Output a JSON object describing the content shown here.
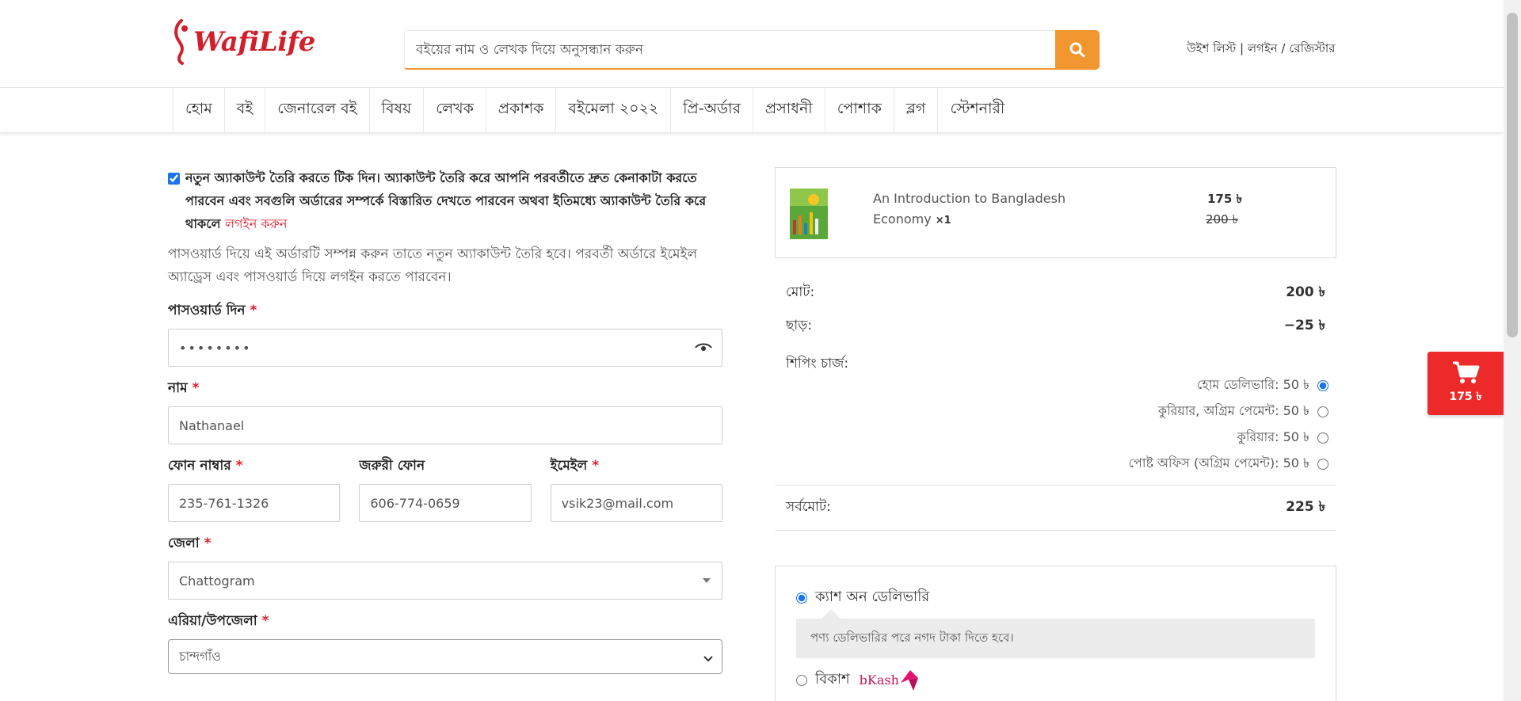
{
  "header": {
    "logo_text": "WafiLife",
    "search_placeholder": "বইয়ের নাম ও লেখক দিয়ে অনুসন্ধান করুন",
    "wishlist": "উইশ লিস্ট",
    "separator": "|",
    "login": "লগইন",
    "slash": "/",
    "register": "রেজিস্টার"
  },
  "nav": {
    "items": [
      "হোম",
      "বই",
      "জেনারেল বই",
      "বিষয়",
      "লেখক",
      "প্রকাশক",
      "বইমেলা ২০২২",
      "প্রি-অর্ডার",
      "প্রসাধনী",
      "পোশাক",
      "ব্লগ",
      "স্টেশনারী"
    ]
  },
  "form": {
    "account_notice": "নতুন অ্যাকাউন্ট তৈরি করতে টিক দিন। অ্যাকাউন্ট তৈরি করে আপনি পরবর্তীতে দ্রুত কেনাকাটা করতে পারবেন এবং সবগুলি অর্ডারের সম্পর্কে বিস্তারিত দেখতে পারবেন অথবা ইতিমধ্যে অ্যাকাউন্ট তৈরি করে থাকলে",
    "login_link": "লগইন করুন",
    "account_checked": true,
    "info_text": "পাসওয়ার্ড দিয়ে এই অর্ডারটি সম্পন্ন করুন তাতে নতুন অ্যাকাউন্ট তৈরি হবে। পরবর্তী অর্ডারে ইমেইল অ্যাড্রেস এবং পাসওয়ার্ড দিয়ে লগইন করতে পারবেন।",
    "required_mark": "*",
    "password_label": "পাসওয়ার্ড দিন",
    "password_value": "••••••••",
    "name_label": "নাম",
    "name_value": "Nathanael",
    "phone_label": "ফোন নাম্বার",
    "phone_value": "235-761-1326",
    "alt_phone_label": "জরুরী ফোন",
    "alt_phone_value": "606-774-0659",
    "email_label": "ইমেইল",
    "email_value": "vsik23@mail.com",
    "district_label": "জেলা",
    "district_value": "Chattogram",
    "area_label": "এরিয়া/উপজেলা",
    "area_value": "চান্দগাঁও"
  },
  "cart": {
    "item_title": "An Introduction to Bangladesh Economy",
    "item_qty": "×1",
    "price_now": "175 ৳",
    "price_old": "200 ৳"
  },
  "totals": {
    "subtotal_label": "মোট:",
    "subtotal_value": "200 ৳",
    "discount_label": "ছাড়:",
    "discount_value": "−25 ৳",
    "shipping_label": "শিপিং চার্জ:",
    "shipping_options": [
      {
        "label": "হোম ডেলিভারি: 50 ৳",
        "checked": true
      },
      {
        "label": "কুরিয়ার, অগ্রিম পেমেন্ট: 50 ৳",
        "checked": false
      },
      {
        "label": "কুরিয়ার: 50 ৳",
        "checked": false
      },
      {
        "label": "পোষ্ট অফিস (অগ্রিম পেমেন্ট): 50 ৳",
        "checked": false
      }
    ],
    "grand_label": "সর্বমোট:",
    "grand_value": "225 ৳"
  },
  "payment": {
    "cod_label": "ক্যাশ অন ডেলিভারি",
    "cod_note": "পণ্য ডেলিভারির পরে নগদ টাকা দিতে হবে।",
    "bkash_label": "বিকাশ",
    "bkash_logo_text": "bKash"
  },
  "floating_cart": {
    "amount": "175 ৳"
  },
  "colors": {
    "brand_red": "#d0202b",
    "accent_orange": "#f2962f",
    "cart_red": "#ed2a2a"
  }
}
